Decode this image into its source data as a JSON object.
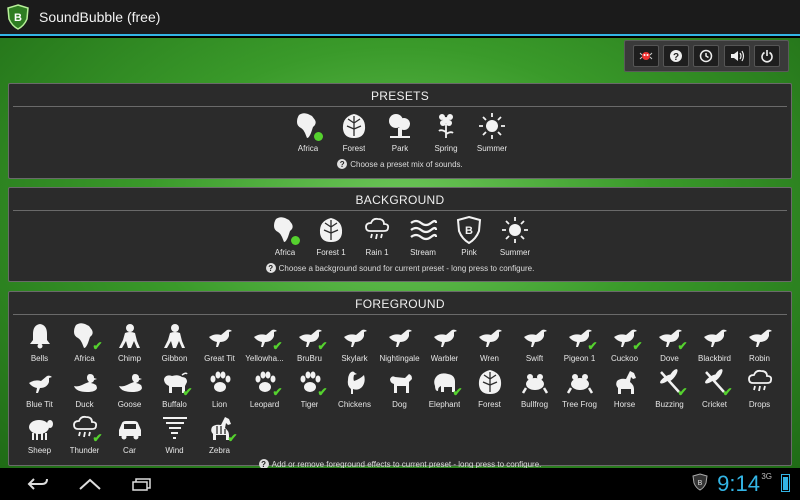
{
  "app": {
    "title": "SoundBubble (free)"
  },
  "toolbar": {
    "buttons": [
      {
        "name": "bug-icon"
      },
      {
        "name": "help-icon"
      },
      {
        "name": "timer-icon"
      },
      {
        "name": "volume-icon"
      },
      {
        "name": "power-icon"
      }
    ]
  },
  "presets": {
    "title": "PRESETS",
    "items": [
      {
        "label": "Africa",
        "icon": "africa-icon",
        "selected": true
      },
      {
        "label": "Forest",
        "icon": "leaf-icon",
        "selected": false
      },
      {
        "label": "Park",
        "icon": "tree-icon",
        "selected": false
      },
      {
        "label": "Spring",
        "icon": "flower-icon",
        "selected": false
      },
      {
        "label": "Summer",
        "icon": "sun-icon",
        "selected": false
      }
    ],
    "hint": "Choose a preset mix of sounds."
  },
  "background": {
    "title": "BACKGROUND",
    "items": [
      {
        "label": "Africa",
        "icon": "africa-icon",
        "selected": true
      },
      {
        "label": "Forest 1",
        "icon": "leaf-icon",
        "selected": false
      },
      {
        "label": "Rain 1",
        "icon": "cloud-rain-icon",
        "selected": false
      },
      {
        "label": "Stream",
        "icon": "waves-icon",
        "selected": false
      },
      {
        "label": "Pink",
        "icon": "shield-icon",
        "selected": false
      },
      {
        "label": "Summer",
        "icon": "sun-icon",
        "selected": false
      }
    ],
    "hint": "Choose a background sound for current preset - long press to configure."
  },
  "foreground": {
    "title": "FOREGROUND",
    "items": [
      {
        "label": "Bells",
        "icon": "bell-icon",
        "checked": false
      },
      {
        "label": "Africa",
        "icon": "africa-icon",
        "checked": true
      },
      {
        "label": "Chimp",
        "icon": "monkey-icon",
        "checked": false
      },
      {
        "label": "Gibbon",
        "icon": "monkey-icon",
        "checked": false
      },
      {
        "label": "Great Tit",
        "icon": "bird-icon",
        "checked": false
      },
      {
        "label": "Yellowha...",
        "icon": "bird-icon",
        "checked": true
      },
      {
        "label": "BruBru",
        "icon": "bird-icon",
        "checked": true
      },
      {
        "label": "Skylark",
        "icon": "bird-icon",
        "checked": false
      },
      {
        "label": "Nightingale",
        "icon": "bird-icon",
        "checked": false
      },
      {
        "label": "Warbler",
        "icon": "bird-icon",
        "checked": false
      },
      {
        "label": "Wren",
        "icon": "bird-icon",
        "checked": false
      },
      {
        "label": "Swift",
        "icon": "bird-icon",
        "checked": false
      },
      {
        "label": "Pigeon 1",
        "icon": "bird-icon",
        "checked": true
      },
      {
        "label": "Cuckoo",
        "icon": "bird-icon",
        "checked": true
      },
      {
        "label": "Dove",
        "icon": "bird-icon",
        "checked": true
      },
      {
        "label": "Blackbird",
        "icon": "bird-icon",
        "checked": false
      },
      {
        "label": "Robin",
        "icon": "bird-icon",
        "checked": false
      },
      {
        "label": "Blue Tit",
        "icon": "bird-icon",
        "checked": false
      },
      {
        "label": "Duck",
        "icon": "duck-icon",
        "checked": false
      },
      {
        "label": "Goose",
        "icon": "duck-icon",
        "checked": false
      },
      {
        "label": "Buffalo",
        "icon": "buffalo-icon",
        "checked": true
      },
      {
        "label": "Lion",
        "icon": "paw-icon",
        "checked": false
      },
      {
        "label": "Leopard",
        "icon": "paw-icon",
        "checked": true
      },
      {
        "label": "Tiger",
        "icon": "paw-icon",
        "checked": true
      },
      {
        "label": "Chickens",
        "icon": "chicken-icon",
        "checked": false
      },
      {
        "label": "Dog",
        "icon": "dog-icon",
        "checked": false
      },
      {
        "label": "Elephant",
        "icon": "elephant-icon",
        "checked": true
      },
      {
        "label": "Forest",
        "icon": "leaf-icon",
        "checked": false
      },
      {
        "label": "Bullfrog",
        "icon": "frog-icon",
        "checked": false
      },
      {
        "label": "Tree Frog",
        "icon": "frog-icon",
        "checked": false
      },
      {
        "label": "Horse",
        "icon": "horse-icon",
        "checked": false
      },
      {
        "label": "Buzzing",
        "icon": "dragonfly-icon",
        "checked": true
      },
      {
        "label": "Cricket",
        "icon": "dragonfly-icon",
        "checked": true
      },
      {
        "label": "Drops",
        "icon": "cloud-rain-icon",
        "checked": false
      },
      {
        "label": "Sheep",
        "icon": "sheep-icon",
        "checked": false
      },
      {
        "label": "Thunder",
        "icon": "cloud-rain-icon",
        "checked": true
      },
      {
        "label": "Car",
        "icon": "car-icon",
        "checked": false
      },
      {
        "label": "Wind",
        "icon": "tornado-icon",
        "checked": false
      },
      {
        "label": "Zebra",
        "icon": "zebra-icon",
        "checked": true
      }
    ],
    "hint": "Add or remove foreground effects to current preset - long press to configure."
  },
  "status": {
    "time": "9:14",
    "network": "3G"
  },
  "colors": {
    "accent": "#33b5e5",
    "check": "#55d12e",
    "panel": "#2b2b2b"
  }
}
